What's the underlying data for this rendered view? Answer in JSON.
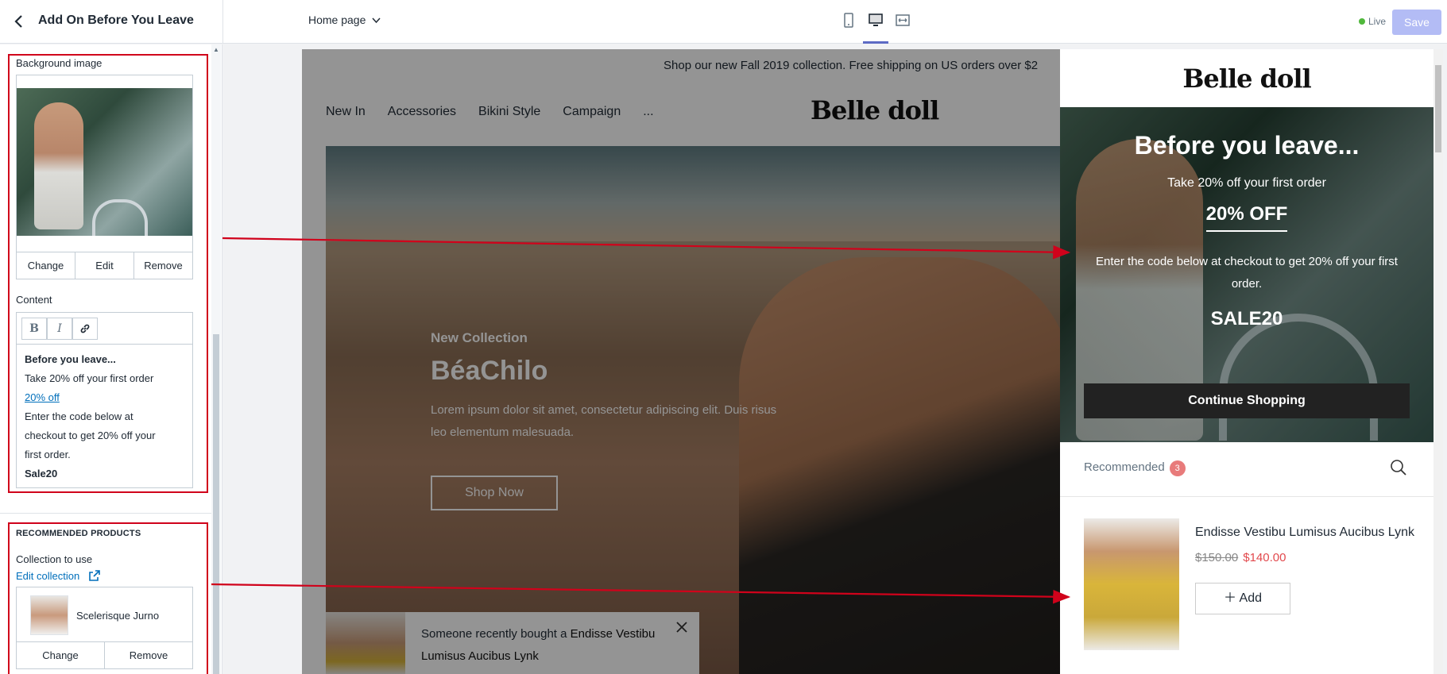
{
  "topbar": {
    "title": "Add On Before You Leave",
    "page_select": "Home page",
    "live": "Live",
    "save": "Save"
  },
  "sidebar": {
    "background_image_label": "Background image",
    "image_buttons": [
      "Change",
      "Edit",
      "Remove"
    ],
    "content_label": "Content",
    "toolbar": {
      "bold": "B",
      "italic": "I"
    },
    "content_lines": {
      "heading": "Before you leave...",
      "line1": "Take 20% off your first order",
      "link": "20% off",
      "line2": "Enter the code below at",
      "line3": "checkout to get 20% off your",
      "line4": "first order.",
      "code": "Sale20"
    },
    "recommended_heading": "RECOMMENDED PRODUCTS",
    "collection_label": "Collection to use",
    "edit_collection": "Edit collection",
    "product_name": "Scelerisque Jurno",
    "product_buttons": [
      "Change",
      "Remove"
    ]
  },
  "preview": {
    "announcement": "Shop our new Fall 2019 collection. Free shipping on US orders over $2",
    "nav": [
      "New In",
      "Accessories",
      "Bikini Style",
      "Campaign",
      "..."
    ],
    "brand": "Belle doll",
    "hero": {
      "kicker": "New Collection",
      "heading": "BéaChilo",
      "text": "Lorem ipsum dolor sit amet, consectetur adipiscing elit. Duis risus leo elementum malesuada.",
      "button": "Shop Now"
    },
    "toast": {
      "prefix": "Someone recently bought a ",
      "product": "Endisse Vestibu Lumisus Aucibus Lynk"
    }
  },
  "drawer": {
    "brand": "Belle doll",
    "heading": "Before you leave...",
    "subheading": "Take 20% off your first order",
    "offer": "20% OFF",
    "paragraph": "Enter the code below at checkout to get 20% off your first order.",
    "code": "SALE20",
    "continue": "Continue Shopping",
    "recommended": "Recommended",
    "recommended_count": "3",
    "product": {
      "name": "Endisse Vestibu Lumisus Aucibus Lynk",
      "old_price": "$150.00",
      "new_price": "$140.00",
      "add": "Add"
    }
  },
  "colors": {
    "highlight": "#d0021b",
    "accent": "#5c6ac4",
    "link": "#006fbb",
    "sale": "#e2494d"
  }
}
